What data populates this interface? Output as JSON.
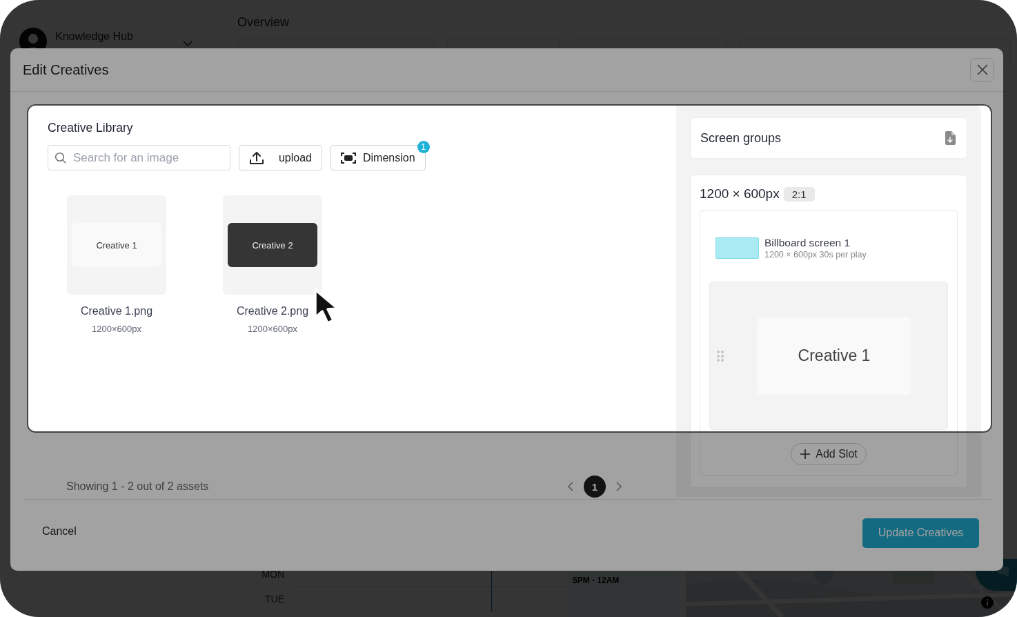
{
  "app": {
    "account": {
      "name": "Knowledge Hub"
    },
    "page_title": "Overview",
    "schedule": {
      "days": [
        "MON",
        "TUE"
      ],
      "event": "5PM - 12AM"
    }
  },
  "dialog": {
    "title": "Edit Creatives",
    "library": {
      "title": "Creative Library",
      "search": {
        "placeholder": "Search for an image"
      },
      "upload_button": "upload",
      "dimension_button": {
        "label": "Dimension",
        "badge": "1"
      },
      "assets": [
        {
          "preview": "Creative 1",
          "kind": "light",
          "name": "Creative 1.png",
          "size": "1200×600px"
        },
        {
          "preview": "Creative 2",
          "kind": "dark",
          "name": "Creative 2.png",
          "size": "1200×600px"
        }
      ],
      "summary": "Showing 1 - 2 out of 2 assets",
      "pages": [
        {
          "label": "1",
          "selected": true
        }
      ]
    },
    "screen_groups": {
      "title": "Screen groups",
      "groups": [
        {
          "size": "1200 × 600px",
          "ratio": "2:1",
          "screens": [
            {
              "name": "Billboard screen 1",
              "details": "1200 × 600px 30s per play"
            }
          ],
          "slots": [
            {
              "creative": "Creative 1"
            }
          ],
          "add_button": "Add Slot"
        }
      ]
    },
    "cancel_button": "Cancel",
    "submit_button": "Update Creatives"
  }
}
